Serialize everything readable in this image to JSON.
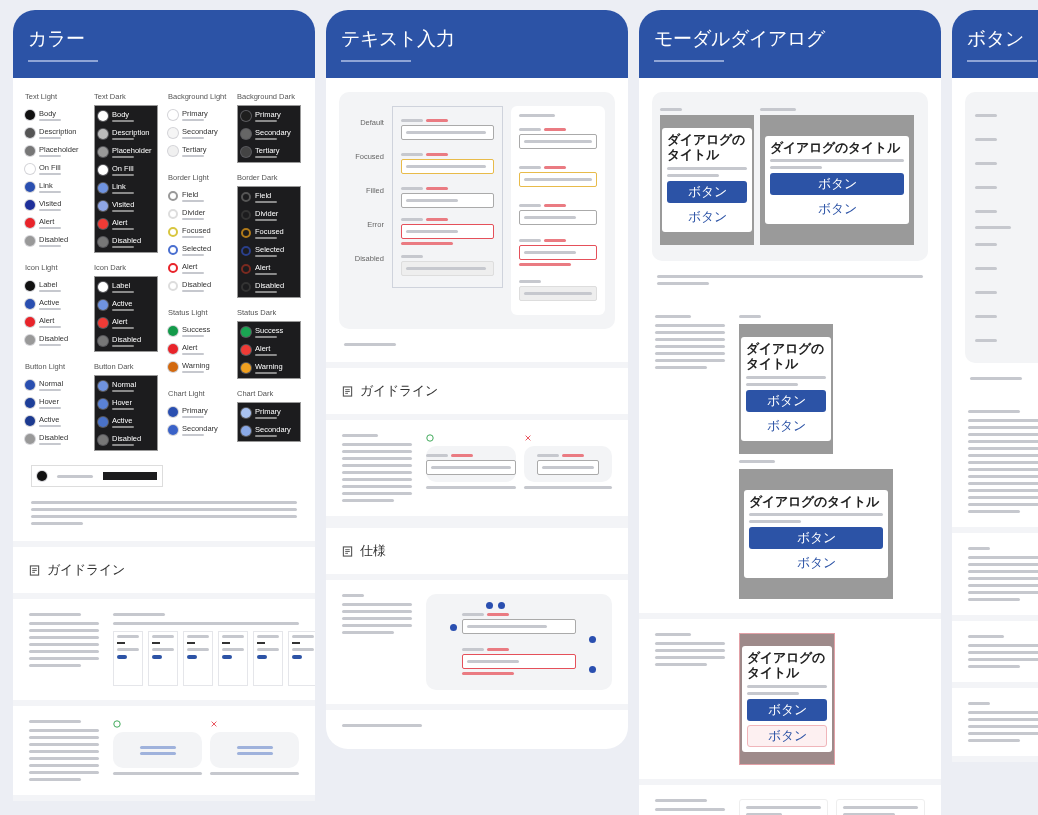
{
  "color_card": {
    "title": "カラー",
    "left": [
      {
        "title": "Text Light",
        "kind": "light",
        "swatches": [
          {
            "name": "Body",
            "kind": "fill",
            "color": "#111111"
          },
          {
            "name": "Description",
            "kind": "fill",
            "color": "#555555"
          },
          {
            "name": "Placeholder",
            "kind": "fill",
            "color": "#777777"
          },
          {
            "name": "On Fill",
            "kind": "fill",
            "color": "#ffffff"
          },
          {
            "name": "Link",
            "kind": "fill",
            "color": "#2a4fb0"
          },
          {
            "name": "Visited",
            "kind": "fill",
            "color": "#1e2f9a"
          },
          {
            "name": "Alert",
            "kind": "fill",
            "color": "#e8242a"
          },
          {
            "name": "Disabled",
            "kind": "fill",
            "color": "#999999"
          }
        ]
      },
      {
        "title": "Text Dark",
        "kind": "dark",
        "swatches": [
          {
            "name": "Body",
            "kind": "fill",
            "color": "#ffffff"
          },
          {
            "name": "Description",
            "kind": "fill",
            "color": "#bbbbbb"
          },
          {
            "name": "Placeholder",
            "kind": "fill",
            "color": "#999999"
          },
          {
            "name": "On Fill",
            "kind": "fill",
            "color": "#ffffff"
          },
          {
            "name": "Link",
            "kind": "fill",
            "color": "#6f93e0"
          },
          {
            "name": "Visited",
            "kind": "fill",
            "color": "#8fa6e6"
          },
          {
            "name": "Alert",
            "kind": "fill",
            "color": "#ef3b36"
          },
          {
            "name": "Disabled",
            "kind": "fill",
            "color": "#777777"
          }
        ]
      },
      {
        "title": "Icon Light",
        "kind": "light",
        "swatches": [
          {
            "name": "Label",
            "kind": "fill",
            "color": "#111111"
          },
          {
            "name": "Active",
            "kind": "fill",
            "color": "#2a4fb0"
          },
          {
            "name": "Alert",
            "kind": "fill",
            "color": "#e8242a"
          },
          {
            "name": "Disabled",
            "kind": "fill",
            "color": "#999999"
          }
        ]
      },
      {
        "title": "Icon Dark",
        "kind": "dark",
        "swatches": [
          {
            "name": "Label",
            "kind": "fill",
            "color": "#ffffff"
          },
          {
            "name": "Active",
            "kind": "fill",
            "color": "#6f93e0"
          },
          {
            "name": "Alert",
            "kind": "fill",
            "color": "#ef3b36"
          },
          {
            "name": "Disabled",
            "kind": "fill",
            "color": "#777777"
          }
        ]
      },
      {
        "title": "Button Light",
        "kind": "light",
        "swatches": [
          {
            "name": "Normal",
            "kind": "fill",
            "color": "#2a4fb0"
          },
          {
            "name": "Hover",
            "kind": "fill",
            "color": "#1e3f99"
          },
          {
            "name": "Active",
            "kind": "fill",
            "color": "#1c3a90"
          },
          {
            "name": "Disabled",
            "kind": "fill",
            "color": "#999999"
          }
        ]
      },
      {
        "title": "Button Dark",
        "kind": "dark",
        "swatches": [
          {
            "name": "Normal",
            "kind": "fill",
            "color": "#6f93e0"
          },
          {
            "name": "Hover",
            "kind": "fill",
            "color": "#5a82d6"
          },
          {
            "name": "Active",
            "kind": "fill",
            "color": "#4a72c8"
          },
          {
            "name": "Disabled",
            "kind": "fill",
            "color": "#777777"
          }
        ]
      }
    ],
    "right": [
      {
        "title": "Background Light",
        "kind": "light",
        "swatches": [
          {
            "name": "Primary",
            "kind": "fill",
            "color": "#ffffff"
          },
          {
            "name": "Secondary",
            "kind": "fill",
            "color": "#f5f5f5"
          },
          {
            "name": "Tertiary",
            "kind": "fill",
            "color": "#f0f0f0"
          }
        ]
      },
      {
        "title": "Background Dark",
        "kind": "dark",
        "swatches": [
          {
            "name": "Primary",
            "kind": "fill",
            "color": "#1e1e1e"
          },
          {
            "name": "Secondary",
            "kind": "fill",
            "color": "#666666"
          },
          {
            "name": "Tertiary",
            "kind": "fill",
            "color": "#444444"
          }
        ]
      },
      {
        "title": "Border Light",
        "kind": "light",
        "swatches": [
          {
            "name": "Field",
            "kind": "ring",
            "color": "#999999"
          },
          {
            "name": "Divider",
            "kind": "ring",
            "color": "#dddddd"
          },
          {
            "name": "Focused",
            "kind": "ring",
            "color": "#d8c640"
          },
          {
            "name": "Selected",
            "kind": "ring",
            "color": "#4a6fd0"
          },
          {
            "name": "Alert",
            "kind": "ring",
            "color": "#e8242a"
          },
          {
            "name": "Disabled",
            "kind": "ring",
            "color": "#dddddd"
          }
        ]
      },
      {
        "title": "Border Dark",
        "kind": "dark",
        "swatches": [
          {
            "name": "Field",
            "kind": "ring",
            "color": "#555555"
          },
          {
            "name": "Divider",
            "kind": "ring",
            "color": "#333333"
          },
          {
            "name": "Focused",
            "kind": "ring",
            "color": "#b07a1a"
          },
          {
            "name": "Selected",
            "kind": "ring",
            "color": "#2a3f8a"
          },
          {
            "name": "Alert",
            "kind": "ring",
            "color": "#7a2a20"
          },
          {
            "name": "Disabled",
            "kind": "ring",
            "color": "#333333"
          }
        ]
      },
      {
        "title": "Status Light",
        "kind": "light",
        "swatches": [
          {
            "name": "Success",
            "kind": "fill",
            "color": "#139a4a"
          },
          {
            "name": "Alert",
            "kind": "fill",
            "color": "#e8242a"
          },
          {
            "name": "Warning",
            "kind": "fill",
            "color": "#d2690f"
          }
        ]
      },
      {
        "title": "Status Dark",
        "kind": "dark",
        "swatches": [
          {
            "name": "Success",
            "kind": "fill",
            "color": "#1aa552"
          },
          {
            "name": "Alert",
            "kind": "fill",
            "color": "#ef3b36"
          },
          {
            "name": "Warning",
            "kind": "fill",
            "color": "#f0a020"
          }
        ]
      },
      {
        "title": "Chart Light",
        "kind": "light",
        "swatches": [
          {
            "name": "Primary",
            "kind": "fill",
            "color": "#2a4fb0"
          },
          {
            "name": "Secondary",
            "kind": "fill",
            "color": "#3a62c8"
          }
        ]
      },
      {
        "title": "Chart Dark",
        "kind": "dark",
        "swatches": [
          {
            "name": "Primary",
            "kind": "fill",
            "color": "#a9c2f0"
          },
          {
            "name": "Secondary",
            "kind": "fill",
            "color": "#8aa9e6"
          }
        ]
      }
    ],
    "guideline_heading": "ガイドライン"
  },
  "text_input_card": {
    "title": "テキスト入力",
    "states": [
      {
        "label": "Default",
        "kind": "default"
      },
      {
        "label": "Focused",
        "kind": "focused"
      },
      {
        "label": "Filled",
        "kind": "filled"
      },
      {
        "label": "Error",
        "kind": "error"
      },
      {
        "label": "Disabled",
        "kind": "disabled"
      }
    ],
    "form_fields": [
      {
        "kind": "default"
      },
      {
        "kind": "focused"
      },
      {
        "kind": "filled"
      },
      {
        "kind": "error"
      },
      {
        "kind": "disabled"
      }
    ],
    "guideline_heading": "ガイドライン",
    "spec_heading": "仕様"
  },
  "modal_card": {
    "title": "モーダルダイアログ",
    "dialogs": [
      {
        "kind": "phone",
        "title": "ダイアログのタイトル",
        "primary_button": "ボタン",
        "secondary_button": "ボタン"
      },
      {
        "kind": "wide",
        "title": "ダイアログのタイトル",
        "primary_button": "ボタン",
        "secondary_button": "ボタン"
      },
      {
        "kind": "phone",
        "title": "ダイアログのタイトル",
        "primary_button": "ボタン",
        "secondary_button": "ボタン"
      },
      {
        "kind": "wide",
        "title": "ダイアログのタイトル",
        "primary_button": "ボタン",
        "secondary_button": "ボタン"
      },
      {
        "kind": "danger",
        "title": "ダイアログのタイトル",
        "primary_button": "ボタン",
        "secondary_button": "ボタン"
      }
    ]
  },
  "button_card": {
    "title": "ボタン"
  }
}
